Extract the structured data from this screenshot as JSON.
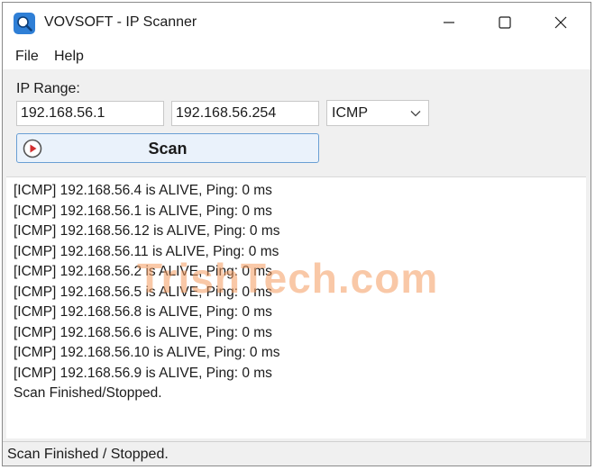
{
  "window": {
    "title": "VOVSOFT - IP Scanner",
    "minimize_icon": "minimize-icon",
    "maximize_icon": "maximize-icon",
    "close_icon": "close-icon",
    "app_icon": "magnifier-icon"
  },
  "menu": {
    "items": [
      "File",
      "Help"
    ]
  },
  "form": {
    "range_label": "IP Range:",
    "start_ip": "192.168.56.1",
    "end_ip": "192.168.56.254",
    "protocol": "ICMP",
    "scan_label": "Scan",
    "scan_icon": "play-circle-icon"
  },
  "log": {
    "lines": [
      "[ICMP] 192.168.56.4 is ALIVE, Ping: 0 ms",
      "[ICMP] 192.168.56.1 is ALIVE, Ping: 0 ms",
      "[ICMP] 192.168.56.12 is ALIVE, Ping: 0 ms",
      "[ICMP] 192.168.56.11 is ALIVE, Ping: 0 ms",
      "[ICMP] 192.168.56.2 is ALIVE, Ping: 0 ms",
      "[ICMP] 192.168.56.5 is ALIVE, Ping: 0 ms",
      "[ICMP] 192.168.56.8 is ALIVE, Ping: 0 ms",
      "[ICMP] 192.168.56.6 is ALIVE, Ping: 0 ms",
      "[ICMP] 192.168.56.10 is ALIVE, Ping: 0 ms",
      "[ICMP] 192.168.56.9 is ALIVE, Ping: 0 ms",
      "Scan Finished/Stopped."
    ]
  },
  "watermark": "TrishTech.com",
  "status": {
    "text": "Scan Finished / Stopped."
  },
  "colors": {
    "accent_border": "#6a9fd4",
    "scan_icon_red": "#d32f2f",
    "watermark": "#f49b5f"
  }
}
